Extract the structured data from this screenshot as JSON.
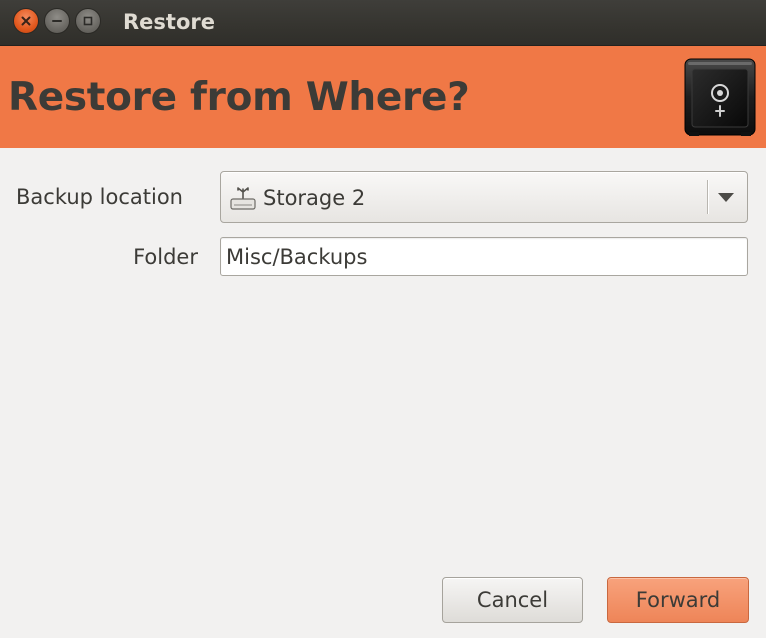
{
  "window": {
    "title": "Restore",
    "controls": [
      "close-icon",
      "minimize-icon",
      "maximize-icon"
    ]
  },
  "header": {
    "title": "Restore from Where?",
    "icon": "safe-icon",
    "background_color": "#f07846"
  },
  "form": {
    "backup_location": {
      "label": "Backup location",
      "selected": "Storage 2",
      "icon": "drive-icon"
    },
    "folder": {
      "label": "Folder",
      "value": "Misc/Backups"
    }
  },
  "buttons": {
    "cancel_label": "Cancel",
    "forward_label": "Forward"
  }
}
